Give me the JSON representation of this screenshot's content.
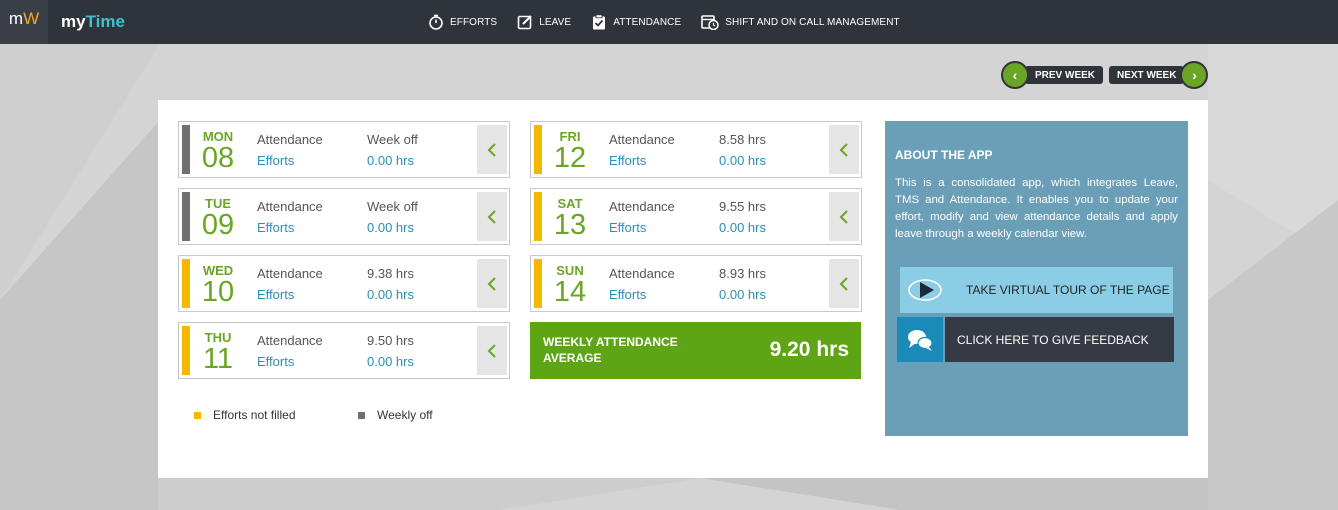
{
  "app": {
    "logo_m": "m",
    "logo_w": "W",
    "name_my": "my",
    "name_time": "Time"
  },
  "nav": [
    {
      "label": "EFFORTS",
      "icon": "stopwatch-icon"
    },
    {
      "label": "LEAVE",
      "icon": "edit-icon"
    },
    {
      "label": "ATTENDANCE",
      "icon": "clipboard-check-icon"
    },
    {
      "label": "SHIFT AND ON CALL MANAGEMENT",
      "icon": "calendar-clock-icon"
    }
  ],
  "week_nav": {
    "prev": "PREV WEEK",
    "next": "NEXT WEEK"
  },
  "colors": {
    "accent_green": "#6aa526",
    "efforts_not_filled": "#f5b800",
    "weekly_off": "#707070",
    "about_bg": "#6b9fb8"
  },
  "days": [
    {
      "name": "MON",
      "num": "08",
      "attendance_label": "Attendance",
      "attendance": "Week off",
      "efforts_label": "Efforts",
      "efforts": "0.00 hrs",
      "status": "weekly_off"
    },
    {
      "name": "TUE",
      "num": "09",
      "attendance_label": "Attendance",
      "attendance": "Week off",
      "efforts_label": "Efforts",
      "efforts": "0.00 hrs",
      "status": "weekly_off"
    },
    {
      "name": "WED",
      "num": "10",
      "attendance_label": "Attendance",
      "attendance": "9.38 hrs",
      "efforts_label": "Efforts",
      "efforts": "0.00 hrs",
      "status": "efforts_not_filled"
    },
    {
      "name": "THU",
      "num": "11",
      "attendance_label": "Attendance",
      "attendance": "9.50 hrs",
      "efforts_label": "Efforts",
      "efforts": "0.00 hrs",
      "status": "efforts_not_filled"
    },
    {
      "name": "FRI",
      "num": "12",
      "attendance_label": "Attendance",
      "attendance": "8.58 hrs",
      "efforts_label": "Efforts",
      "efforts": "0.00 hrs",
      "status": "efforts_not_filled"
    },
    {
      "name": "SAT",
      "num": "13",
      "attendance_label": "Attendance",
      "attendance": "9.55 hrs",
      "efforts_label": "Efforts",
      "efforts": "0.00 hrs",
      "status": "efforts_not_filled"
    },
    {
      "name": "SUN",
      "num": "14",
      "attendance_label": "Attendance",
      "attendance": "8.93 hrs",
      "efforts_label": "Efforts",
      "efforts": "0.00 hrs",
      "status": "efforts_not_filled"
    }
  ],
  "weekly_average": {
    "label": "WEEKLY ATTENDANCE AVERAGE",
    "value": "9.20 hrs"
  },
  "legend": {
    "efforts_not_filled": "Efforts not filled",
    "weekly_off": "Weekly off"
  },
  "about": {
    "title": "ABOUT THE APP",
    "text": "This is a consolidated app, which integrates Leave, TMS and Attendance. It enables you to update your effort, modify and view attendance details and apply leave through a weekly calendar view.",
    "tour_label": "TAKE VIRTUAL TOUR OF THE PAGE",
    "feedback_label": "CLICK HERE TO GIVE FEEDBACK"
  }
}
